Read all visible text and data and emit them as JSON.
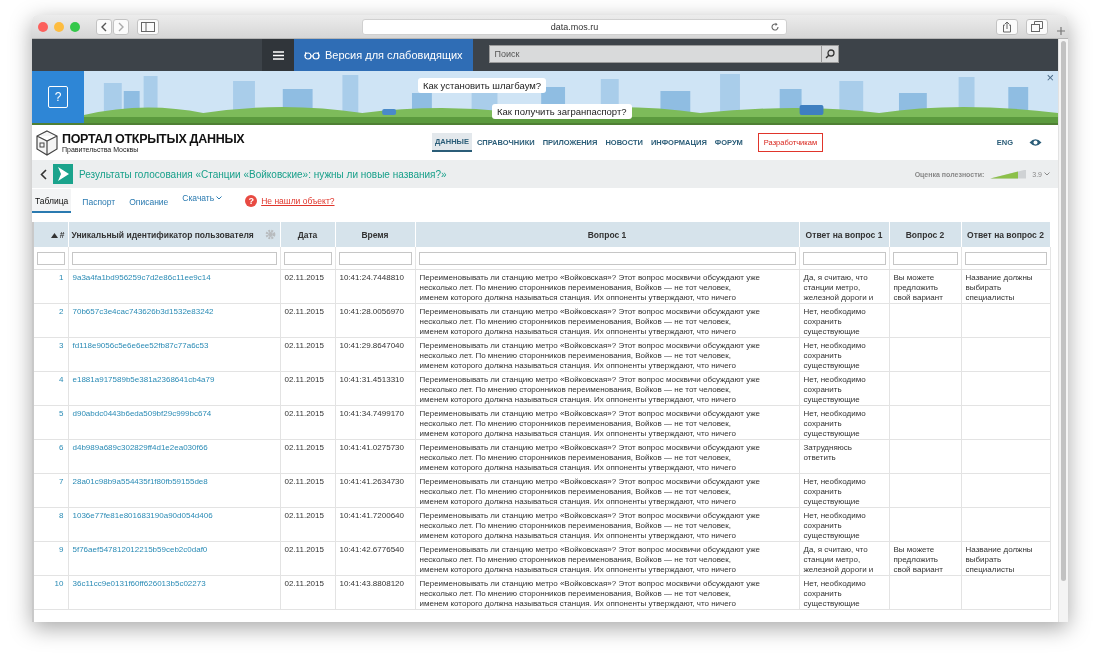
{
  "browser": {
    "url": "data.mos.ru"
  },
  "site_bar": {
    "accessibility_button": "Версия для слабовидящих",
    "search": {
      "placeholder": "Поиск"
    }
  },
  "banner": {
    "icon_glyph": "?",
    "close_glyph": "×",
    "bubbles": [
      "Как установить шлагбаум?",
      "Как получить загранпаспорт?"
    ]
  },
  "portal": {
    "title": "ПОРТАЛ ОТКРЫТЫХ ДАННЫХ",
    "subtitle": "Правительства Москвы",
    "nav": [
      {
        "label": "ДАННЫЕ",
        "selected": true
      },
      {
        "label": "СПРАВОЧНИКИ",
        "selected": false
      },
      {
        "label": "ПРИЛОЖЕНИЯ",
        "selected": false
      },
      {
        "label": "НОВОСТИ",
        "selected": false
      },
      {
        "label": "ИНФОРМАЦИЯ",
        "selected": false
      },
      {
        "label": "ФОРУМ",
        "selected": false
      }
    ],
    "developers_button": "Разработчикам",
    "language": "ENG"
  },
  "dataset": {
    "title": "Результаты голосования «Станции «Войковские»: нужны ли новые названия?»",
    "rating_label": "Оценка полезности:",
    "rating": {
      "level": 0.78,
      "value": "3.9"
    }
  },
  "tabs": [
    {
      "label": "Таблица",
      "selected": true,
      "kind": "tab"
    },
    {
      "label": "Паспорт",
      "selected": false,
      "kind": "tab"
    },
    {
      "label": "Описание",
      "selected": false,
      "kind": "tab"
    },
    {
      "label": "Скачать",
      "selected": false,
      "kind": "dropdown"
    }
  ],
  "help": {
    "glyph": "?",
    "link": "Не нашли объект?"
  },
  "table": {
    "columns": [
      {
        "label": "#",
        "sorted": true
      },
      {
        "label": "Уникальный идентификатор пользователя",
        "sorted": false
      },
      {
        "label": "Дата",
        "sorted": false
      },
      {
        "label": "Время",
        "sorted": false
      },
      {
        "label": "Вопрос 1",
        "sorted": false
      },
      {
        "label": "Ответ на вопрос 1",
        "sorted": false
      },
      {
        "label": "Вопрос 2",
        "sorted": false
      },
      {
        "label": "Ответ на вопрос 2",
        "sorted": false
      }
    ],
    "rows": [
      {
        "number": "1",
        "id": "9a3a4fa1bd956259c7d2e86c11ee9c14",
        "date": "02.11.2015",
        "time": "10:41:24.7448810",
        "question_1": [
          "Переименовывать ли станцию метро «Войковская»? Этот вопрос москвичи обсуждают уже",
          "несколько лет. По мнению сторонников переименования, Войков — не тот человек,",
          "именем которого должна называться станция. Их оппоненты утверждают, что ничего"
        ],
        "answer_1": [
          "Да, я считаю, что",
          "станции метро,",
          "железной дороги и"
        ],
        "question_2": [
          "Вы можете",
          "предложить",
          "свой вариант"
        ],
        "answer_2": [
          "Название должны",
          "выбирать",
          "специалисты"
        ]
      },
      {
        "number": "2",
        "id": "70b657c3e4cac743626b3d1532e83242",
        "date": "02.11.2015",
        "time": "10:41:28.0056970",
        "question_1": [
          "Переименовывать ли станцию метро «Войковская»? Этот вопрос москвичи обсуждают уже",
          "несколько лет. По мнению сторонников переименования, Войков — не тот человек,",
          "именем которого должна называться станция. Их оппоненты утверждают, что ничего"
        ],
        "answer_1": [
          "Нет, необходимо",
          "сохранить",
          "существующие"
        ]
      },
      {
        "number": "3",
        "id": "fd118e9056c5e6e6ee52fb87c77a6c53",
        "date": "02.11.2015",
        "time": "10:41:29.8647040",
        "question_1": [
          "Переименовывать ли станцию метро «Войковская»? Этот вопрос москвичи обсуждают уже",
          "несколько лет. По мнению сторонников переименования, Войков — не тот человек,",
          "именем которого должна называться станция. Их оппоненты утверждают, что ничего"
        ],
        "answer_1": [
          "Нет, необходимо",
          "сохранить",
          "существующие"
        ]
      },
      {
        "number": "4",
        "id": "e1881a917589b5e381a2368641cb4a79",
        "date": "02.11.2015",
        "time": "10:41:31.4513310",
        "question_1": [
          "Переименовывать ли станцию метро «Войковская»? Этот вопрос москвичи обсуждают уже",
          "несколько лет. По мнению сторонников переименования, Войков — не тот человек,",
          "именем которого должна называться станция. Их оппоненты утверждают, что ничего"
        ],
        "answer_1": [
          "Нет, необходимо",
          "сохранить",
          "существующие"
        ]
      },
      {
        "number": "5",
        "id": "d90abdc0443b6eda509bf29c999bc674",
        "date": "02.11.2015",
        "time": "10:41:34.7499170",
        "question_1": [
          "Переименовывать ли станцию метро «Войковская»? Этот вопрос москвичи обсуждают уже",
          "несколько лет. По мнению сторонников переименования, Войков — не тот человек,",
          "именем которого должна называться станция. Их оппоненты утверждают, что ничего"
        ],
        "answer_1": [
          "Нет, необходимо",
          "сохранить",
          "существующие"
        ]
      },
      {
        "number": "6",
        "id": "d4b989a689c302829ff4d1e2ea030f66",
        "date": "02.11.2015",
        "time": "10:41:41.0275730",
        "question_1": [
          "Переименовывать ли станцию метро «Войковская»? Этот вопрос москвичи обсуждают уже",
          "несколько лет. По мнению сторонников переименования, Войков — не тот человек,",
          "именем которого должна называться станция. Их оппоненты утверждают, что ничего"
        ],
        "answer_1": [
          "Затрудняюсь",
          "ответить"
        ]
      },
      {
        "number": "7",
        "id": "28a01c98b9a554435f1f80fb59155de8",
        "date": "02.11.2015",
        "time": "10:41:41.2634730",
        "question_1": [
          "Переименовывать ли станцию метро «Войковская»? Этот вопрос москвичи обсуждают уже",
          "несколько лет. По мнению сторонников переименования, Войков — не тот человек,",
          "именем которого должна называться станция. Их оппоненты утверждают, что ничего"
        ],
        "answer_1": [
          "Нет, необходимо",
          "сохранить",
          "существующие"
        ]
      },
      {
        "number": "8",
        "id": "1036e77fe81e801683190a90d054d406",
        "date": "02.11.2015",
        "time": "10:41:41.7200640",
        "question_1": [
          "Переименовывать ли станцию метро «Войковская»? Этот вопрос москвичи обсуждают уже",
          "несколько лет. По мнению сторонников переименования, Войков — не тот человек,",
          "именем которого должна называться станция. Их оппоненты утверждают, что ничего"
        ],
        "answer_1": [
          "Нет, необходимо",
          "сохранить",
          "существующие"
        ]
      },
      {
        "number": "9",
        "id": "5f76aef547812012215b59ceb2c0daf0",
        "date": "02.11.2015",
        "time": "10:41:42.6776540",
        "question_1": [
          "Переименовывать ли станцию метро «Войковская»? Этот вопрос москвичи обсуждают уже",
          "несколько лет. По мнению сторонников переименования, Войков — не тот человек,",
          "именем которого должна называться станция. Их оппоненты утверждают, что ничего"
        ],
        "answer_1": [
          "Да, я считаю, что",
          "станции метро,",
          "железной дороги и"
        ],
        "question_2": [
          "Вы можете",
          "предложить",
          "свой вариант"
        ],
        "answer_2": [
          "Название должны",
          "выбирать",
          "специалисты"
        ]
      },
      {
        "number": "10",
        "id": "36c11cc9e0131f60ff626013b5c02273",
        "date": "02.11.2015",
        "time": "10:41:43.8808120",
        "question_1": [
          "Переименовывать ли станцию метро «Войковская»? Этот вопрос москвичи обсуждают уже",
          "несколько лет. По мнению сторонников переименования, Войков — не тот человек,",
          "именем которого должна называться станция. Их оппоненты утверждают, что ничего"
        ],
        "answer_1": [
          "Нет, необходимо",
          "сохранить",
          "существующие"
        ]
      }
    ]
  }
}
